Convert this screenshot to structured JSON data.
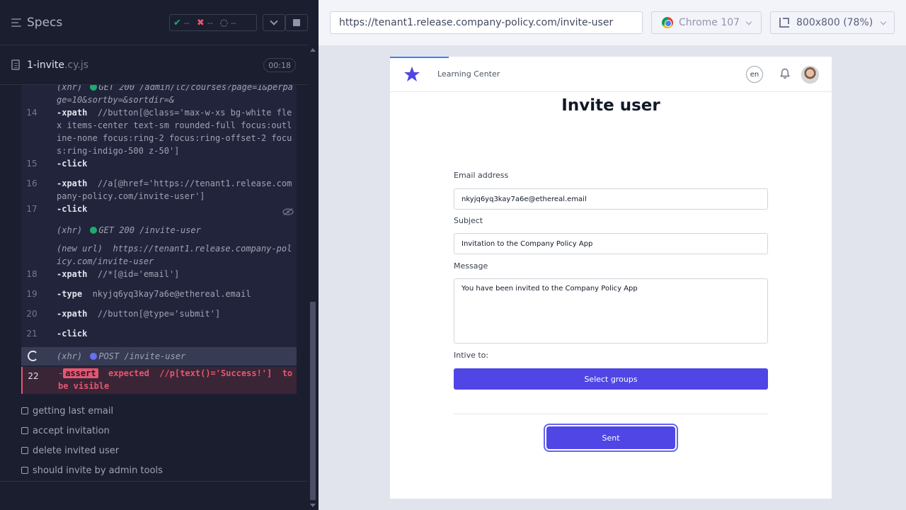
{
  "reporter": {
    "specs_label": "Specs",
    "stats": {
      "passed": "--",
      "failed": "--",
      "pending": "--"
    },
    "file": {
      "name": "1-invite",
      "ext": ".cy.js",
      "duration": "00:18"
    },
    "commands": [
      {
        "num": "",
        "name": "(xhr)",
        "status_dot": "green",
        "message": "GET 200 /admin/lc/courses?page=1&perpage=10&sortby=&sortdir=&"
      },
      {
        "num": "14",
        "name": "-xpath",
        "message": "//button[@class='max-w-xs bg-white flex items-center text-sm rounded-full focus:outline-none focus:ring-2 focus:ring-offset-2 focus:ring-indigo-500 z-50']"
      },
      {
        "num": "15",
        "name": "-click",
        "message": ""
      },
      {
        "num": "16",
        "name": "-xpath",
        "message": "//a[@href='https://tenant1.release.company-policy.com/invite-user']"
      },
      {
        "num": "17",
        "name": "-click",
        "message": ""
      },
      {
        "num": "",
        "name": "(xhr)",
        "status_dot": "green",
        "message": "GET 200 /invite-user"
      },
      {
        "num": "",
        "name": "(new url)",
        "message": "https://tenant1.release.company-policy.com/invite-user"
      },
      {
        "num": "18",
        "name": "-xpath",
        "message": "//*[@id='email']"
      },
      {
        "num": "19",
        "name": "-type",
        "message": "nkyjq6yq3kay7a6e@ethereal.email"
      },
      {
        "num": "20",
        "name": "-xpath",
        "message": "//button[@type='submit']"
      },
      {
        "num": "21",
        "name": "-click",
        "message": ""
      },
      {
        "num": "",
        "name": "(xhr)",
        "status_dot": "blue",
        "message": "POST /invite-user"
      },
      {
        "num": "22",
        "name": "-",
        "badge": "assert",
        "message_pre": "expected",
        "message_sel": "//p[text()='Success!']",
        "message_post": "to be visible"
      }
    ],
    "tests": [
      "getting last email",
      "accept invitation",
      "delete invited user",
      "should invite by admin tools"
    ]
  },
  "aut_header": {
    "url": "https://tenant1.release.company-policy.com/invite-user",
    "browser": "Chrome 107",
    "viewport": "800x800",
    "scale": "(78%)"
  },
  "app": {
    "brand": "Learning Center",
    "lang": "en",
    "title": "Invite user",
    "email_label": "Email address",
    "email_value": "nkyjq6yq3kay7a6e@ethereal.email",
    "subject_label": "Subject",
    "subject_value": "Invitation to the Company Policy App",
    "message_label": "Message",
    "message_value": "You have been invited to the Company Policy App",
    "invite_to_label": "Intive to:",
    "select_groups": "Select groups",
    "submit": "Sent"
  },
  "colors": {
    "accent": "#4f46e5",
    "pass": "#1fa971",
    "fail": "#e45770",
    "reporter_bg": "#1b1e2e"
  }
}
